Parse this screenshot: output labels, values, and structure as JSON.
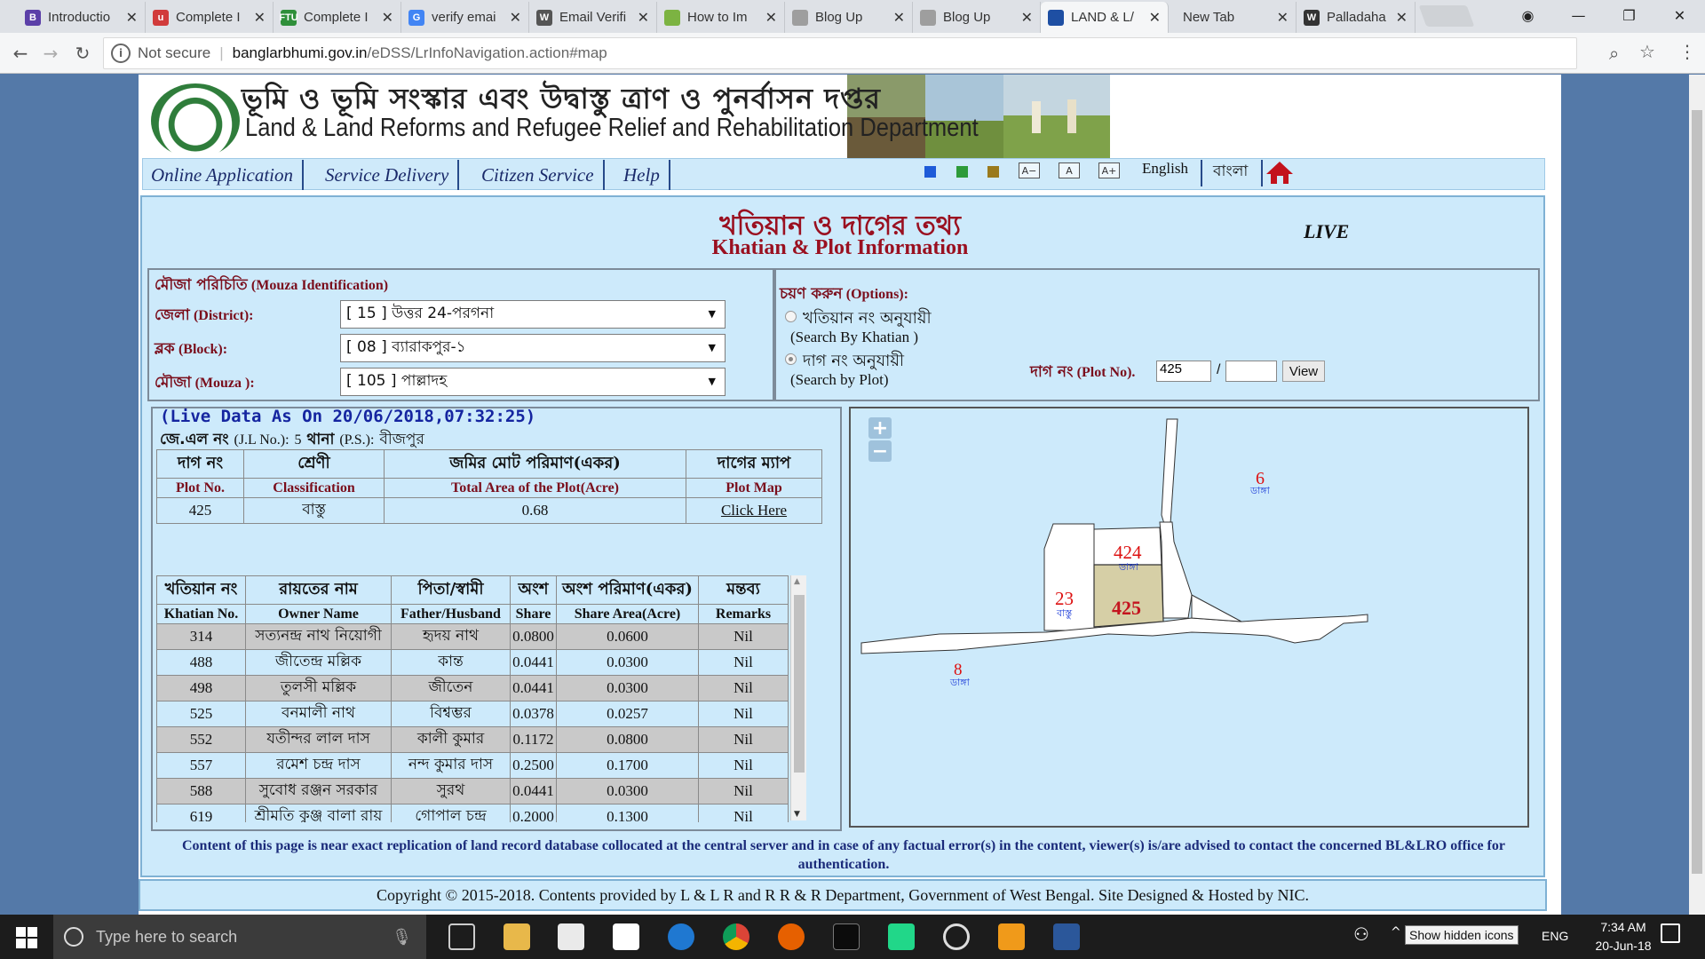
{
  "browser": {
    "tabs": [
      {
        "title": "Introductio",
        "icon_color": "#5b3fa8",
        "icon_letter": "B"
      },
      {
        "title": "Complete I",
        "icon_color": "#d13b3b",
        "icon_letter": "u"
      },
      {
        "title": "Complete I",
        "icon_color": "#2f8f3a",
        "icon_letter": "FTU"
      },
      {
        "title": "verify emai",
        "icon_color": "#4285f4",
        "icon_letter": "G"
      },
      {
        "title": "Email Verifi",
        "icon_color": "#555555",
        "icon_letter": "W"
      },
      {
        "title": "How to Im",
        "icon_color": "#7cb342",
        "icon_letter": ""
      },
      {
        "title": "Blog Up",
        "icon_color": "#9e9e9e",
        "icon_letter": ""
      },
      {
        "title": "Blog Up",
        "icon_color": "#9e9e9e",
        "icon_letter": ""
      },
      {
        "title": "LAND & L/",
        "icon_color": "#1e4fa3",
        "icon_letter": ""
      },
      {
        "title": "New Tab",
        "icon_color": "",
        "icon_letter": ""
      },
      {
        "title": "Palladaha",
        "icon_color": "#333333",
        "icon_letter": "W"
      }
    ],
    "not_secure": "Not secure",
    "url_domain": "banglarbhumi.gov.in",
    "url_path": "/eDSS/LrInfoNavigation.action#map"
  },
  "header": {
    "dept_bn": "ভূমি ও ভূমি সংস্কার এবং উদ্বাস্তু ত্রাণ ও পুনর্বাসন দপ্তর",
    "dept_en": "Land & Land Reforms and Refugee Relief and Rehabilitation Department"
  },
  "menu": {
    "items": [
      "Online Application",
      "Service Delivery",
      "Citizen Service",
      "Help"
    ],
    "font_small": "A−",
    "font_normal": "A",
    "font_large": "A+",
    "english": "English",
    "bangla": "বাংলা",
    "theme_colors": [
      "#1e5bd8",
      "#2e9b3a",
      "#9a7a1c"
    ]
  },
  "title": {
    "bn": "খতিয়ান ও দাগের তথ্য",
    "en": "Khatian & Plot Information",
    "live": "LIVE"
  },
  "mouza": {
    "heading_bn": "মৌজা পরিচিতি",
    "heading_en": "(Mouza Identification)",
    "district_bn": "জেলা",
    "district_en": "(District):",
    "district_value": "[ 15 ] উত্তর 24-পরগনা",
    "block_bn": "ব্লক",
    "block_en": "(Block):",
    "block_value": "[ 08 ] ব্যারাকপুর-১",
    "mouza_bn": "মৌজা",
    "mouza_en": "(Mouza ):",
    "mouza_value": "[ 105 ] পাল্লাদহ"
  },
  "options": {
    "heading_bn": "চয়ণ করুন",
    "heading_en": "(Options):",
    "by_khatian_bn": "খতিয়ান নং অনুযায়ী",
    "by_khatian_en": "(Search By Khatian )",
    "by_plot_bn": "দাগ নং অনুযায়ী",
    "by_plot_en": "(Search by Plot)",
    "plot_no_bn": "দাগ নং",
    "plot_no_en": "(Plot No).",
    "plot_value": "425",
    "slash": "/",
    "plot_value2": "",
    "view_label": "View"
  },
  "live_data": {
    "as_on": "(Live Data As On 20/06/2018,07:32:25)",
    "jl_bn": "জে.এল নং",
    "jl_en": "(J.L No.):",
    "jl_value": "5",
    "ps_bn": "থানা",
    "ps_en": "(P.S.):",
    "ps_value": "বীজপুর"
  },
  "plot_table": {
    "headers_bn": [
      "দাগ নং",
      "শ্রেণী",
      "জমির মোট পরিমাণ(একর)",
      "দাগের ম্যাপ"
    ],
    "headers_en": [
      "Plot No.",
      "Classification",
      "Total Area of the Plot(Acre)",
      "Plot Map"
    ],
    "row": {
      "plot": "425",
      "class": "বাস্তু",
      "area": "0.68",
      "map": "Click Here"
    }
  },
  "owner_table": {
    "headers_bn": [
      "খতিয়ান নং",
      "রায়তের নাম",
      "পিতা/স্বামী",
      "অংশ",
      "অংশ পরিমাণ(একর)",
      "মন্তব্য"
    ],
    "headers_en": [
      "Khatian No.",
      "Owner Name",
      "Father/Husband",
      "Share",
      "Share Area(Acre)",
      "Remarks"
    ],
    "rows": [
      {
        "khatian": "314",
        "owner": "সত্যনন্দ্র নাথ নিয়োগী",
        "father": "হৃদয় নাথ",
        "share": "0.0800",
        "area": "0.0600",
        "remarks": "Nil"
      },
      {
        "khatian": "488",
        "owner": "জীতেন্দ্র মল্লিক",
        "father": "কান্ত",
        "share": "0.0441",
        "area": "0.0300",
        "remarks": "Nil"
      },
      {
        "khatian": "498",
        "owner": "তুলসী মল্লিক",
        "father": "জীতেন",
        "share": "0.0441",
        "area": "0.0300",
        "remarks": "Nil"
      },
      {
        "khatian": "525",
        "owner": "বনমালী নাথ",
        "father": "বিশ্বম্ভর",
        "share": "0.0378",
        "area": "0.0257",
        "remarks": "Nil"
      },
      {
        "khatian": "552",
        "owner": "যতীন্দর লাল দাস",
        "father": "কালী কুমার",
        "share": "0.1172",
        "area": "0.0800",
        "remarks": "Nil"
      },
      {
        "khatian": "557",
        "owner": "রমেশ চন্দ্র দাস",
        "father": "নন্দ কুমার দাস",
        "share": "0.2500",
        "area": "0.1700",
        "remarks": "Nil"
      },
      {
        "khatian": "588",
        "owner": "সুবোধ রঞ্জন সরকার",
        "father": "সুরথ",
        "share": "0.0441",
        "area": "0.0300",
        "remarks": "Nil"
      },
      {
        "khatian": "619",
        "owner": "শ্রীমতি কুঞ্জ বালা রায়",
        "father": "গোপাল চন্দ্র",
        "share": "0.2000",
        "area": "0.1300",
        "remarks": "Nil"
      }
    ]
  },
  "map": {
    "zoom_in": "+",
    "zoom_out": "−",
    "labels": [
      {
        "plot": "6",
        "class": "ডাঙ্গা"
      },
      {
        "plot": "424",
        "class": "ডাঙ্গা"
      },
      {
        "plot": "23",
        "class": "বাস্তু"
      },
      {
        "plot": "425",
        "class": ""
      },
      {
        "plot": "8",
        "class": "ডাঙ্গা"
      }
    ],
    "selected_fill": "#d6cfa6"
  },
  "footer": {
    "notice": "Content of this page is near exact replication of land record database collocated at the central server and in case of any factual error(s) in the content, viewer(s) is/are advised to contact the concerned BL&LRO office for authentication.",
    "copyright": "Copyright © 2015-2018. Contents provided by L & L R and R R & R Department, Government of West Bengal. Site Designed & Hosted by NIC."
  },
  "taskbar": {
    "search_placeholder": "Type here to search",
    "show_hidden": "Show hidden icons",
    "lang": "ENG",
    "time": "7:34 AM",
    "date": "20-Jun-18"
  }
}
